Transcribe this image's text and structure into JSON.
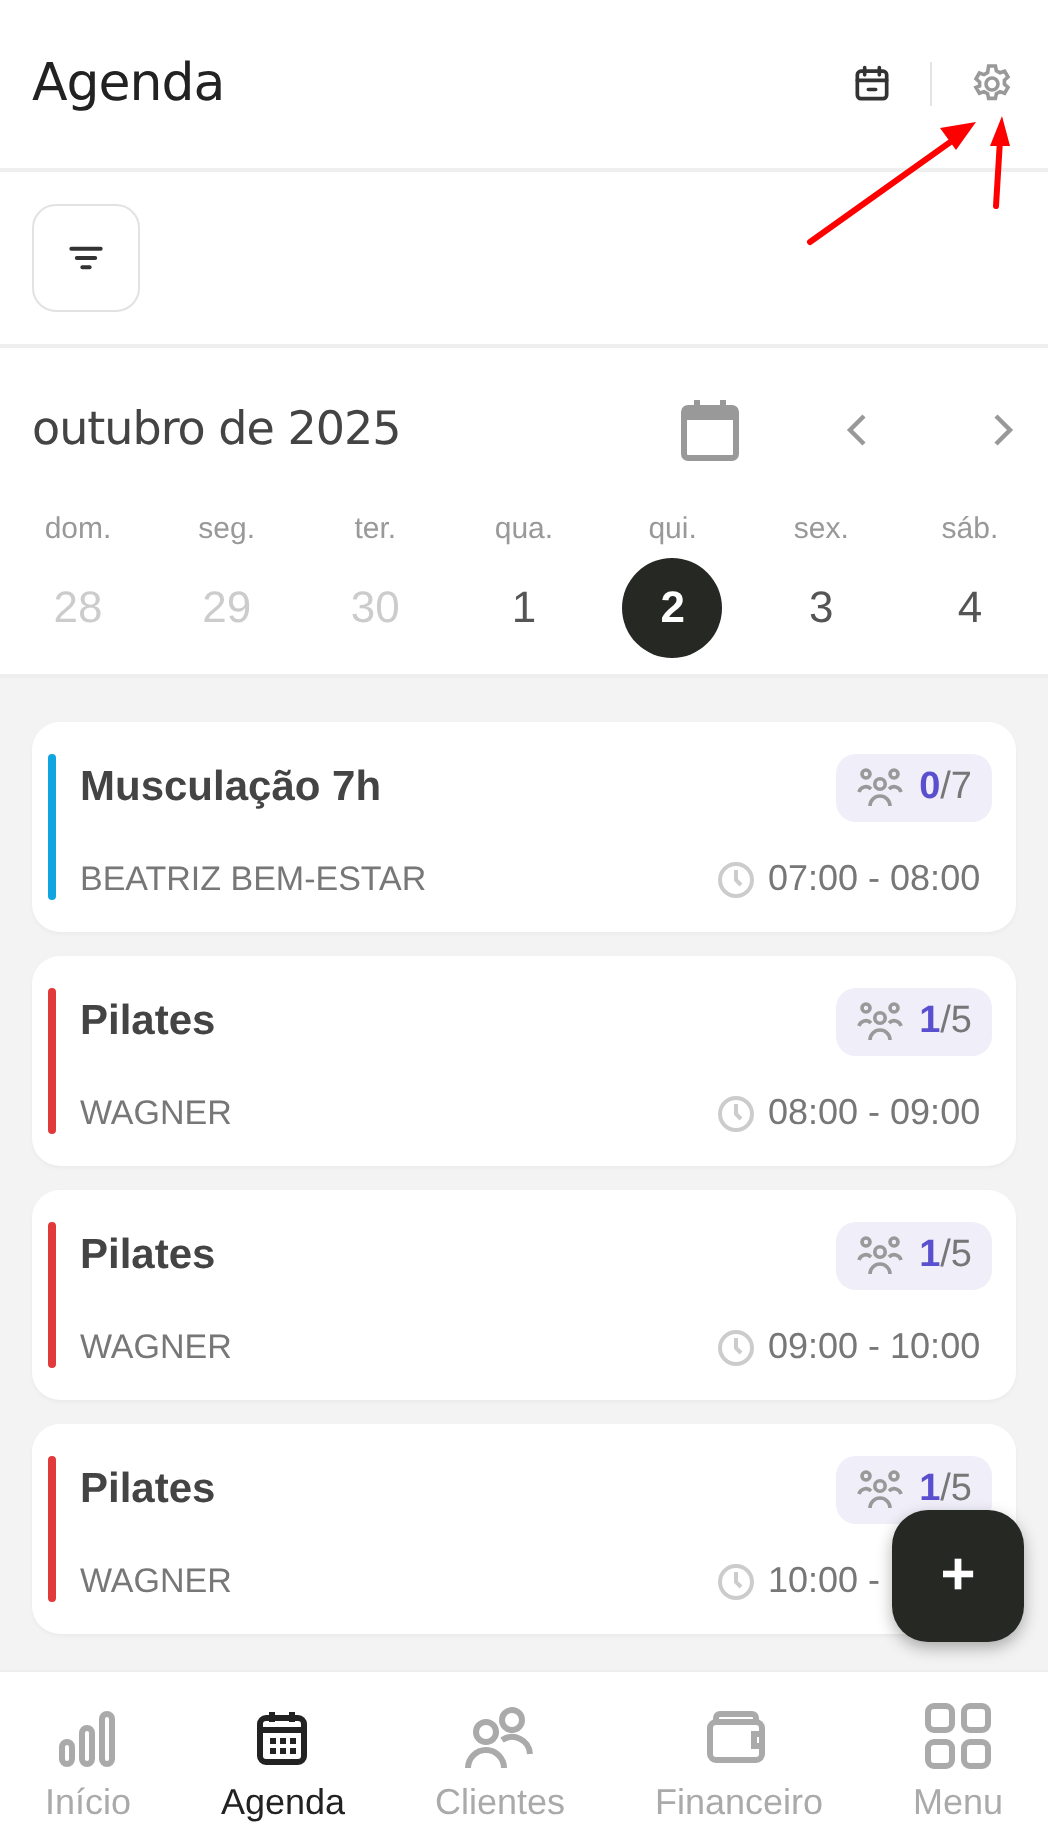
{
  "header": {
    "title": "Agenda"
  },
  "calendar": {
    "month_label": "outubro de 2025",
    "days": [
      {
        "weekday": "dom.",
        "day": "28",
        "outside_month": true,
        "selected": false
      },
      {
        "weekday": "seg.",
        "day": "29",
        "outside_month": true,
        "selected": false
      },
      {
        "weekday": "ter.",
        "day": "30",
        "outside_month": true,
        "selected": false
      },
      {
        "weekday": "qua.",
        "day": "1",
        "outside_month": false,
        "selected": false
      },
      {
        "weekday": "qui.",
        "day": "2",
        "outside_month": false,
        "selected": true
      },
      {
        "weekday": "sex.",
        "day": "3",
        "outside_month": false,
        "selected": false
      },
      {
        "weekday": "sáb.",
        "day": "4",
        "outside_month": false,
        "selected": false
      }
    ]
  },
  "classes": [
    {
      "title": "Musculação 7h",
      "instructor": "BEATRIZ BEM-ESTAR",
      "booked": "0",
      "capacity": "/7",
      "time": "07:00 - 08:00",
      "color": "#0ea5e0"
    },
    {
      "title": "Pilates",
      "instructor": "WAGNER",
      "booked": "1",
      "capacity": "/5",
      "time": "08:00 - 09:00",
      "color": "#e03a3a"
    },
    {
      "title": "Pilates",
      "instructor": "WAGNER",
      "booked": "1",
      "capacity": "/5",
      "time": "09:00 - 10:00",
      "color": "#e03a3a"
    },
    {
      "title": "Pilates",
      "instructor": "WAGNER",
      "booked": "1",
      "capacity": "/5",
      "time": "10:00 -",
      "color": "#e03a3a"
    }
  ],
  "fab": {
    "label": "+"
  },
  "nav": [
    {
      "label": "Início",
      "kind": "chart",
      "selected": false
    },
    {
      "label": "Agenda",
      "kind": "calendar",
      "selected": true
    },
    {
      "label": "Clientes",
      "kind": "people",
      "selected": false
    },
    {
      "label": "Financeiro",
      "kind": "wallet",
      "selected": false
    },
    {
      "label": "Menu",
      "kind": "grid",
      "selected": false
    }
  ]
}
